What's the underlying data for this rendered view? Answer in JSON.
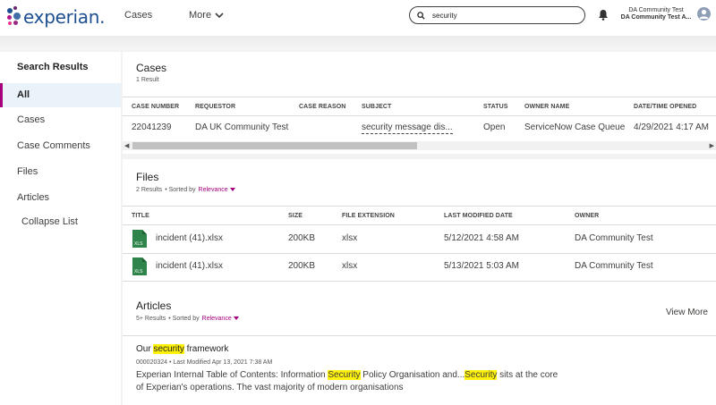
{
  "header": {
    "logo_text": "experian.",
    "nav": {
      "cases": "Cases",
      "more": "More"
    },
    "search": {
      "value": "security"
    },
    "user": {
      "line1": "DA Community Test",
      "line2": "DA Community Test A..."
    }
  },
  "sidebar": {
    "title": "Search Results",
    "items": [
      "All",
      "Cases",
      "Case Comments",
      "Files",
      "Articles",
      "Collapse List"
    ],
    "active_color": "#a7007f"
  },
  "cases": {
    "title": "Cases",
    "count": "1 Result",
    "columns": [
      "CASE NUMBER",
      "REQUESTOR",
      "CASE REASON",
      "SUBJECT",
      "STATUS",
      "OWNER NAME",
      "DATE/TIME OPENED"
    ],
    "rows": [
      {
        "case_number": "22041239",
        "requestor": "DA UK Community Test",
        "case_reason": "",
        "subject": "security message dis...",
        "status": "Open",
        "owner_name": "ServiceNow Case Queue",
        "opened": "4/29/2021 4:17 AM"
      }
    ]
  },
  "files": {
    "title": "Files",
    "count": "2 Results",
    "sorted_by": "• Sorted by",
    "sort": "Relevance",
    "columns": [
      "TITLE",
      "SIZE",
      "FILE EXTENSION",
      "LAST MODIFIED DATE",
      "OWNER"
    ],
    "rows": [
      {
        "icon": "XLS",
        "title": "incident (41).xlsx",
        "size": "200KB",
        "ext": "xlsx",
        "modified": "5/12/2021 4:58 AM",
        "owner": "DA Community Test"
      },
      {
        "icon": "XLS",
        "title": "incident (41).xlsx",
        "size": "200KB",
        "ext": "xlsx",
        "modified": "5/13/2021 5:03 AM",
        "owner": "DA Community Test"
      }
    ]
  },
  "articles": {
    "title": "Articles",
    "count": "5+ Results",
    "sorted_by": "• Sorted by",
    "sort": "Relevance",
    "view_more": "View More",
    "item": {
      "title_pre": "Our ",
      "title_hl": "security",
      "title_post": " framework",
      "number": "000020324",
      "meta": "•  Last Modified  Apr 13, 2021 7:38 AM",
      "body_1": "Experian Internal Table of Contents: Information ",
      "body_hl1": "Security",
      "body_2": " Policy Organisation and...",
      "body_hl2": "Security",
      "body_3": " sits at the core",
      "body_line2": "of Experian's operations. The vast majority of modern organisations"
    }
  }
}
